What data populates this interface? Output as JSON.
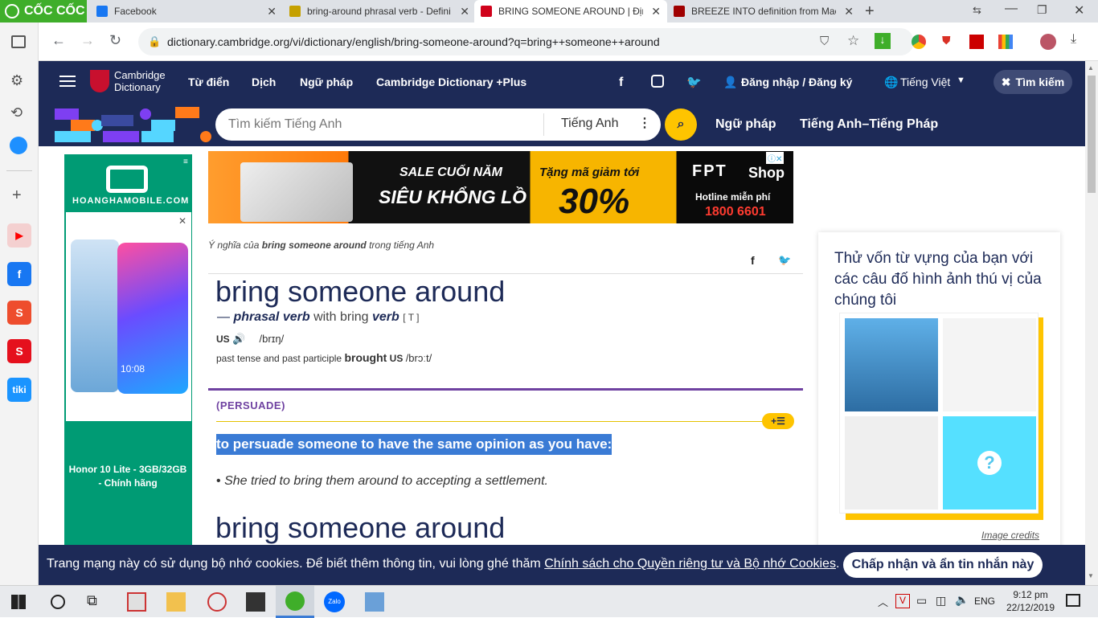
{
  "browser": {
    "brand": "CỐC CỐC",
    "tabs": [
      {
        "title": "Facebook",
        "color": "#1877f2"
      },
      {
        "title": "bring-around phrasal verb - Defini",
        "color": "#c5a000"
      },
      {
        "title": "BRING SOMEONE AROUND | Định",
        "color": "#d0021b"
      },
      {
        "title": "BREEZE INTO definition from Macm",
        "color": "#a00000"
      }
    ],
    "new_tab": "+",
    "url": "dictionary.cambridge.org/vi/dictionary/english/bring-someone-around?q=bring++someone++around"
  },
  "sidebar": {
    "apps": [
      {
        "name": "youtube",
        "color": "#ff0000",
        "glyph": "▶"
      },
      {
        "name": "facebook",
        "color": "#1877f2",
        "glyph": "f"
      },
      {
        "name": "shopee",
        "color": "#ee4d2d",
        "glyph": "S"
      },
      {
        "name": "sendo",
        "color": "#e5101d",
        "glyph": "S"
      },
      {
        "name": "tiki",
        "color": "#1a94ff",
        "glyph": "tiki"
      }
    ]
  },
  "header": {
    "logo_line1": "Cambridge",
    "logo_line2": "Dictionary",
    "nav": [
      "Từ điển",
      "Dịch",
      "Ngữ pháp",
      "Cambridge Dictionary +Plus"
    ],
    "login": "Đăng nhập / Đăng ký",
    "language": "Tiếng Việt",
    "search_toggle": "Tìm kiếm",
    "search_placeholder": "Tìm kiếm Tiếng Anh",
    "search_lang": "Tiếng Anh",
    "sub_nav": [
      "Ngữ pháp",
      "Tiếng Anh–Tiếng Pháp"
    ]
  },
  "ad_left": {
    "brand": "HOANGHAMOBILE.COM",
    "phone_time": "10:08",
    "caption": "Honor 10 Lite - 3GB/32GB - Chính hãng"
  },
  "ad_banner": {
    "line1": "SALE CUỐI NĂM",
    "line2": "SIÊU KHỔNG LỒ",
    "promo_label": "Tặng mã giảm tới",
    "promo_value": "30%",
    "shop_brand": "FPT",
    "shop_word": "Shop",
    "hotline_label": "Hotline miễn phí",
    "hotline": "1800 6601"
  },
  "entry": {
    "meaning_prefix": "Ý nghĩa của",
    "meaning_word": "bring someone around",
    "meaning_suffix": "trong tiếng Anh",
    "headword": "bring someone around",
    "pos_dash": "—",
    "pos": "phrasal verb",
    "with_text": "with bring",
    "verb": "verb",
    "grammar": "[ T ]",
    "region_us": "US",
    "ipa": "/brɪŋ/",
    "past_label": "past tense and past participle",
    "past_form": "brought",
    "past_region": "US",
    "past_ipa": "/brɔːt/",
    "guideword": "(PERSUADE)",
    "definition": "to persuade someone to have the same opinion as you have:",
    "example": "She tried to bring them around to accepting a settlement.",
    "headword2": "bring someone around"
  },
  "quiz": {
    "title": "Thử vốn từ vựng của bạn với các câu đố hình ảnh thú vị của chúng tôi",
    "question_mark": "?",
    "credits": "Image credits"
  },
  "cookie": {
    "text": "Trang mạng này có sử dụng bộ nhớ cookies. Để biết thêm thông tin, vui lòng ghé thăm",
    "link": "Chính sách cho Quyền riêng tư và Bộ nhớ Cookies",
    "period": ".",
    "accept": "Chấp nhận và ẩn tin nhắn này"
  },
  "taskbar": {
    "language": "ENG",
    "time": "9:12 pm",
    "date": "22/12/2019",
    "zalo": "Zalo"
  },
  "colors": {
    "cambridge_navy": "#1d2a57",
    "accent_yellow": "#fec400",
    "selection": "#3a7bd5",
    "guideword": "#6f42a1"
  }
}
